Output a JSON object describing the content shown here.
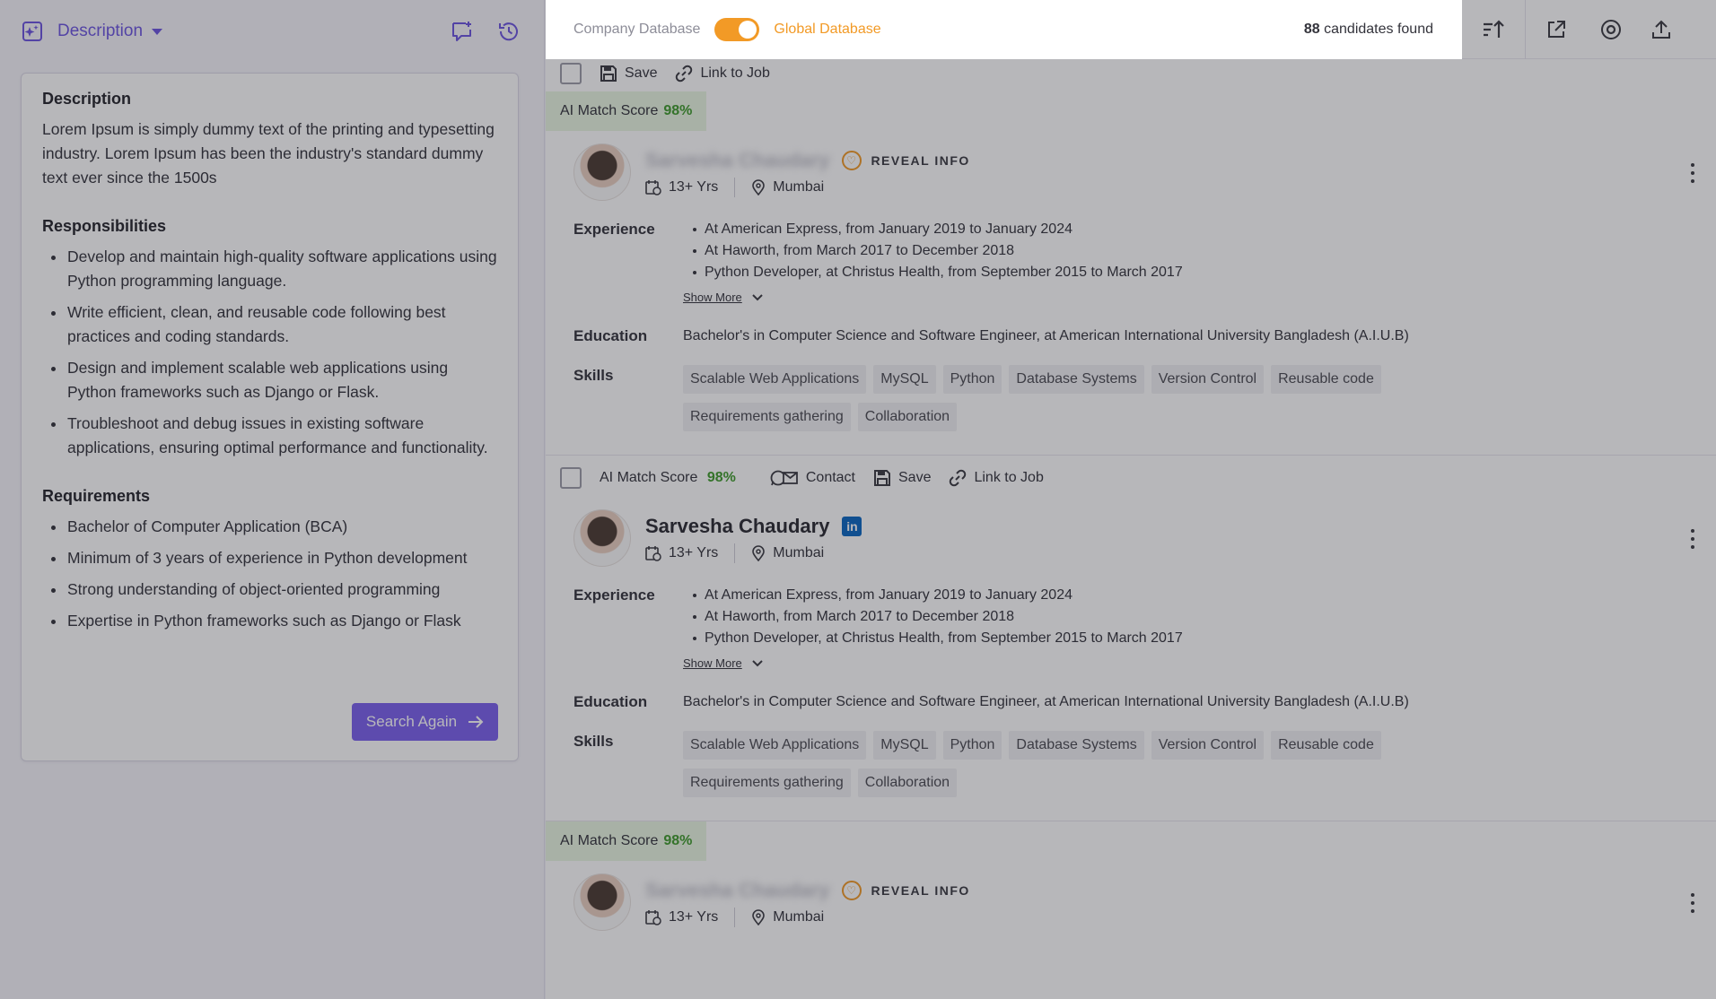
{
  "left": {
    "dropdown_label": "Description",
    "description": {
      "heading": "Description",
      "text": "Lorem Ipsum is simply dummy text of the printing and typesetting industry. Lorem Ipsum has been the industry's standard dummy text ever since the 1500s"
    },
    "responsibilities": {
      "heading": "Responsibilities",
      "items": [
        "Develop and maintain high-quality software applications using Python programming language.",
        "Write efficient, clean, and reusable code following best practices and coding standards.",
        "Design and implement scalable web applications using Python frameworks such as Django or Flask.",
        "Troubleshoot and debug issues in existing software applications, ensuring optimal performance and functionality."
      ]
    },
    "requirements": {
      "heading": "Requirements",
      "items": [
        "Bachelor of Computer Application (BCA)",
        "Minimum of 3 years of experience in Python development",
        "Strong understanding of object-oriented programming",
        "Expertise in Python frameworks such as Django or Flask"
      ]
    },
    "search_again_label": "Search Again"
  },
  "topbar": {
    "company_db": "Company Database",
    "global_db": "Global Database",
    "count": "88",
    "count_suffix": "candidates found"
  },
  "actions": {
    "save": "Save",
    "link_to_job": "Link to Job",
    "contact": "Contact",
    "score_label": "AI Match Score",
    "reveal": "REVEAL INFO",
    "show_more": "Show More",
    "experience_label": "Experience",
    "education_label": "Education",
    "skills_label": "Skills"
  },
  "candidates": [
    {
      "score": "98%",
      "name": "Sarvesha Chaudary",
      "years": "13+ Yrs",
      "location": "Mumbai",
      "experience": [
        "At American Express, from January 2019 to January 2024",
        "At Haworth, from March 2017 to December 2018",
        "Python Developer, at Christus Health, from September 2015 to March 2017"
      ],
      "education": "Bachelor's in Computer Science and Software Engineer, at American International University Bangladesh (A.I.U.B)",
      "skills": [
        "Scalable Web Applications",
        "MySQL",
        "Python",
        "Database Systems",
        "Version Control",
        "Reusable code",
        "Requirements gathering",
        "Collaboration"
      ]
    },
    {
      "score": "98%",
      "name": "Sarvesha Chaudary",
      "years": "13+ Yrs",
      "location": "Mumbai",
      "experience": [
        "At American Express, from January 2019 to January 2024",
        "At Haworth, from March 2017 to December 2018",
        "Python Developer, at Christus Health, from September 2015 to March 2017"
      ],
      "education": "Bachelor's in Computer Science and Software Engineer, at American International University Bangladesh (A.I.U.B)",
      "skills": [
        "Scalable Web Applications",
        "MySQL",
        "Python",
        "Database Systems",
        "Version Control",
        "Reusable code",
        "Requirements gathering",
        "Collaboration"
      ]
    },
    {
      "score": "98%",
      "name": "Sarvesha Chaudary",
      "years": "13+ Yrs",
      "location": "Mumbai"
    }
  ],
  "colors": {
    "accent": "#7b61ee",
    "toggle": "#f29a26",
    "score": "#3f9b2c"
  }
}
